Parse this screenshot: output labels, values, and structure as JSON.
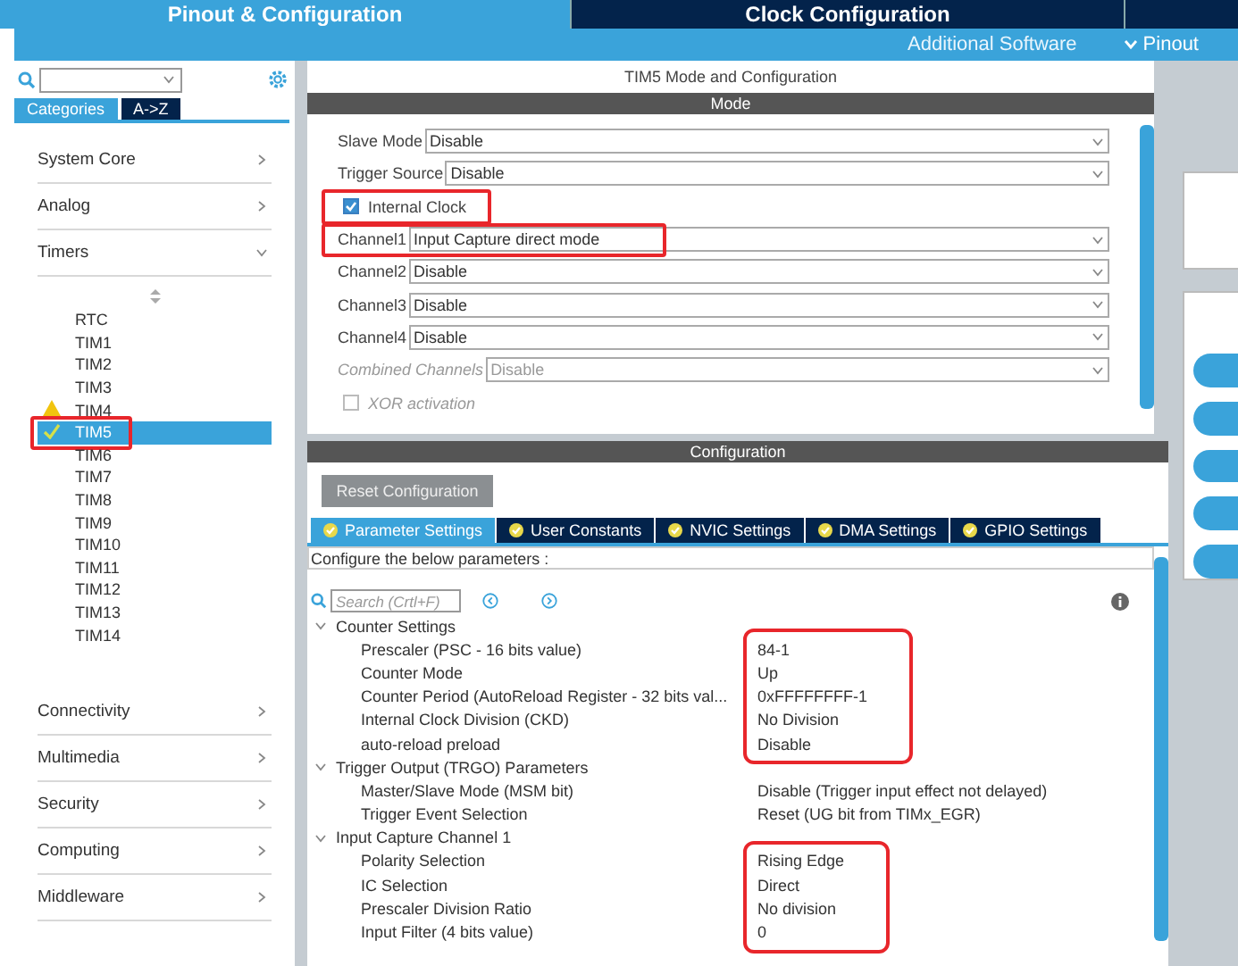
{
  "top_tabs": [
    {
      "label": "Pinout & Configuration",
      "selected": true
    },
    {
      "label": "Clock Configuration",
      "selected": false
    }
  ],
  "sub_bar": {
    "additional_software": "Additional Software",
    "pinout_menu": "Pinout"
  },
  "sidebar": {
    "view_tabs": [
      {
        "label": "Categories",
        "selected": true
      },
      {
        "label": "A->Z",
        "selected": false
      }
    ],
    "categories": [
      {
        "label": "System Core",
        "expanded": false
      },
      {
        "label": "Analog",
        "expanded": false
      },
      {
        "label": "Timers",
        "expanded": true,
        "children": [
          {
            "label": "RTC",
            "selected": false,
            "configured": false,
            "warning": false,
            "highlighted": false
          },
          {
            "label": "TIM1",
            "selected": false,
            "configured": false,
            "warning": false,
            "highlighted": false
          },
          {
            "label": "TIM2",
            "selected": false,
            "configured": false,
            "warning": false,
            "highlighted": false
          },
          {
            "label": "TIM3",
            "selected": false,
            "configured": false,
            "warning": false,
            "highlighted": false
          },
          {
            "label": "TIM4",
            "selected": false,
            "configured": false,
            "warning": true,
            "highlighted": false
          },
          {
            "label": "TIM5",
            "selected": true,
            "configured": true,
            "warning": false,
            "highlighted": true
          },
          {
            "label": "TIM6",
            "selected": false,
            "configured": false,
            "warning": false,
            "highlighted": false
          },
          {
            "label": "TIM7",
            "selected": false,
            "configured": false,
            "warning": false,
            "highlighted": false
          },
          {
            "label": "TIM8",
            "selected": false,
            "configured": false,
            "warning": false,
            "highlighted": false
          },
          {
            "label": "TIM9",
            "selected": false,
            "configured": false,
            "warning": false,
            "highlighted": false
          },
          {
            "label": "TIM10",
            "selected": false,
            "configured": false,
            "warning": false,
            "highlighted": false
          },
          {
            "label": "TIM11",
            "selected": false,
            "configured": false,
            "warning": false,
            "highlighted": false
          },
          {
            "label": "TIM12",
            "selected": false,
            "configured": false,
            "warning": false,
            "highlighted": false
          },
          {
            "label": "TIM13",
            "selected": false,
            "configured": false,
            "warning": false,
            "highlighted": false
          },
          {
            "label": "TIM14",
            "selected": false,
            "configured": false,
            "warning": false,
            "highlighted": false
          }
        ]
      },
      {
        "label": "Connectivity",
        "expanded": false
      },
      {
        "label": "Multimedia",
        "expanded": false
      },
      {
        "label": "Security",
        "expanded": false
      },
      {
        "label": "Computing",
        "expanded": false
      },
      {
        "label": "Middleware",
        "expanded": false
      }
    ]
  },
  "mode_panel": {
    "title": "TIM5 Mode and Configuration",
    "header": "Mode",
    "fields": [
      {
        "kind": "select",
        "label": "Slave Mode",
        "value": "Disable",
        "disabled": false,
        "highlighted": false
      },
      {
        "kind": "select",
        "label": "Trigger Source",
        "value": "Disable",
        "disabled": false,
        "highlighted": false
      },
      {
        "kind": "checkbox",
        "label": "Internal Clock",
        "checked": true,
        "disabled": false,
        "highlighted": true
      },
      {
        "kind": "select",
        "label": "Channel1",
        "value": "Input Capture direct mode",
        "disabled": false,
        "highlighted": true
      },
      {
        "kind": "select",
        "label": "Channel2",
        "value": "Disable",
        "disabled": false,
        "highlighted": false
      },
      {
        "kind": "select",
        "label": "Channel3",
        "value": "Disable",
        "disabled": false,
        "highlighted": false
      },
      {
        "kind": "select",
        "label": "Channel4",
        "value": "Disable",
        "disabled": false,
        "highlighted": false
      },
      {
        "kind": "select",
        "label": "Combined Channels",
        "value": "Disable",
        "disabled": true,
        "highlighted": false
      },
      {
        "kind": "checkbox",
        "label": "XOR activation",
        "checked": false,
        "disabled": true,
        "highlighted": false
      }
    ]
  },
  "config_panel": {
    "header": "Configuration",
    "reset_button": "Reset Configuration",
    "tabs": [
      {
        "label": "Parameter Settings",
        "selected": true
      },
      {
        "label": "User Constants",
        "selected": false
      },
      {
        "label": "NVIC Settings",
        "selected": false
      },
      {
        "label": "DMA Settings",
        "selected": false
      },
      {
        "label": "GPIO Settings",
        "selected": false
      }
    ],
    "hint": "Configure the below parameters :",
    "search": {
      "placeholder": "Search (Crtl+F)"
    },
    "groups": [
      {
        "label": "Counter Settings",
        "expanded": true,
        "highlighted": true,
        "params": [
          {
            "name": "Prescaler (PSC - 16 bits value)",
            "value": "84-1"
          },
          {
            "name": "Counter Mode",
            "value": "Up"
          },
          {
            "name": "Counter Period (AutoReload Register - 32 bits val...",
            "value": "0xFFFFFFFF-1"
          },
          {
            "name": "Internal Clock Division (CKD)",
            "value": "No Division"
          },
          {
            "name": "auto-reload preload",
            "value": "Disable"
          }
        ]
      },
      {
        "label": "Trigger Output (TRGO) Parameters",
        "expanded": true,
        "highlighted": false,
        "params": [
          {
            "name": "Master/Slave Mode (MSM bit)",
            "value": "Disable (Trigger input effect not delayed)"
          },
          {
            "name": "Trigger Event Selection",
            "value": "Reset (UG bit from TIMx_EGR)"
          }
        ]
      },
      {
        "label": "Input Capture Channel 1",
        "expanded": true,
        "highlighted": true,
        "params": [
          {
            "name": "Polarity Selection",
            "value": "Rising Edge"
          },
          {
            "name": "IC Selection",
            "value": "Direct"
          },
          {
            "name": "Prescaler Division Ratio",
            "value": "No division"
          },
          {
            "name": "Input Filter (4 bits value)",
            "value": "0"
          }
        ]
      }
    ]
  }
}
